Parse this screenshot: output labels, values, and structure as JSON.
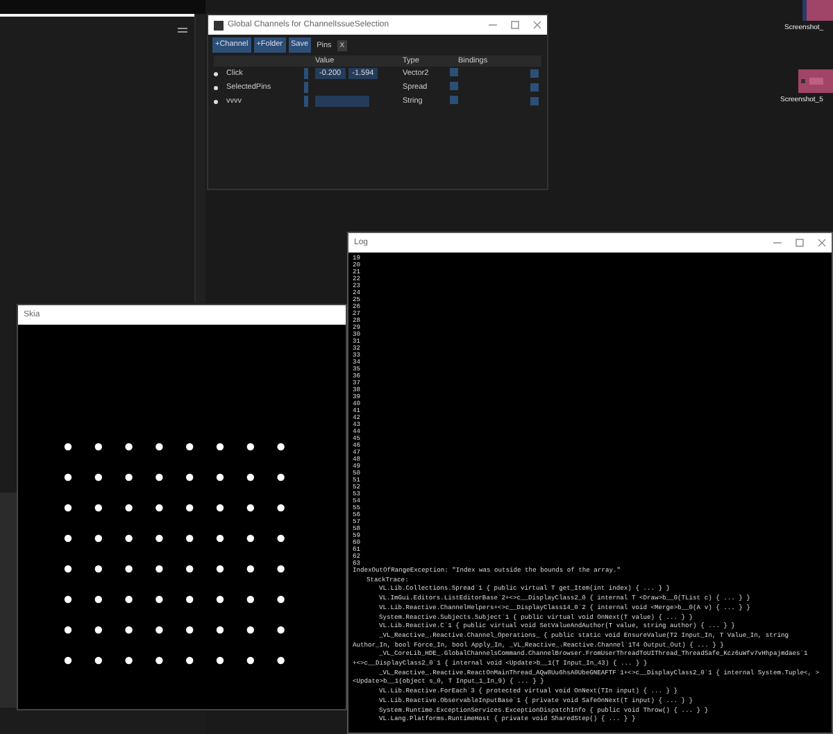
{
  "desktop_icons": [
    {
      "label": "Screenshot_"
    },
    {
      "label": "Screenshot_5"
    }
  ],
  "global_channels": {
    "title": "Global Channels for ChannelIssueSelection",
    "toolbar": [
      "+Channel",
      "+Folder",
      "Save"
    ],
    "tab": {
      "label": "Pins",
      "close": "X"
    },
    "columns": [
      "Value",
      "Type",
      "Bindings"
    ],
    "rows": [
      {
        "name": "Click",
        "kind": "vector",
        "values": [
          "-0.200",
          "-1.594"
        ],
        "type": "Vector2"
      },
      {
        "name": "SelectedPins",
        "kind": "spread",
        "type": "Spread"
      },
      {
        "name": "vvvv",
        "kind": "string",
        "type": "String"
      }
    ]
  },
  "skia": {
    "title": "Skia"
  },
  "log": {
    "title": "Log",
    "numbers": [
      "19",
      "20",
      "21",
      "22",
      "23",
      "24",
      "25",
      "26",
      "27",
      "28",
      "29",
      "30",
      "31",
      "32",
      "33",
      "34",
      "35",
      "36",
      "37",
      "38",
      "39",
      "40",
      "41",
      "42",
      "43",
      "44",
      "45",
      "46",
      "47",
      "48",
      "49",
      "50",
      "51",
      "52",
      "53",
      "54",
      "55",
      "56",
      "57",
      "58",
      "59",
      "60",
      "61",
      "62",
      "63"
    ],
    "exception": [
      {
        "kind": "message",
        "text": "IndexOutOfRangeException: \"Index was outside the bounds of the array.\""
      },
      {
        "kind": "label",
        "text": "StackTrace:"
      },
      {
        "kind": "frame",
        "text": "VL.Lib.Collections.Spread`1 { public virtual T get_Item(int index) { ... } }"
      },
      {
        "kind": "frame",
        "text": "VL.ImGui.Editors.ListEditorBase`2+<>c__DisplayClass2_0 { internal T <Draw>b__0(TList c) { ... } }"
      },
      {
        "kind": "frame",
        "text": "VL.Lib.Reactive.ChannelHelpers+<>c__DisplayClass14_0`2 { internal void <Merge>b__0(A v) { ... } }"
      },
      {
        "kind": "frame",
        "text": "System.Reactive.Subjects.Subject`1 { public virtual void OnNext(T value) { ... } }"
      },
      {
        "kind": "frame",
        "text": "VL.Lib.Reactive.C`1 { public virtual void SetValueAndAuthor(T value, string author) { ... } }"
      },
      {
        "kind": "frame",
        "text": "_VL_Reactive_.Reactive.Channel_Operations_ { public static void EnsureValue(T2 Input_In, T Value_In, string"
      },
      {
        "kind": "wrap",
        "text": "Author_In, bool Force_In, bool Apply_In, _VL_Reactive_.Reactive.Channel`1T4 Output_Out) { ... } }"
      },
      {
        "kind": "frame",
        "text": "_VL_CoreLib_HDE_.GlobalChannelsCommand.ChannelBrowser.FromUserThreadToUIThread_ThreadSafe_Kcz6uWfv7vHhpajmdaes`1"
      },
      {
        "kind": "wrap",
        "text": "+<>c__DisplayClass2_0`1 { internal void <Update>b__1(T Input_In_43) { ... } }"
      },
      {
        "kind": "frame",
        "text": "_VL_Reactive_.Reactive.ReactOnMainThread_AQw8Uu6hsA0UbeGNEAFTF`1+<>c__DisplayClass2_0`1 { internal System.Tuple<, >"
      },
      {
        "kind": "wrap",
        "text": "<Update>b__1(object s_0, T Input_1_In_9) { ... } }"
      },
      {
        "kind": "frame",
        "text": "VL.Lib.Reactive.ForEach`3 { protected virtual void OnNext(TIn input) { ... } }"
      },
      {
        "kind": "frame",
        "text": "VL.Lib.Reactive.ObservableInputBase`1 { private void SafeOnNext(T input) { ... } }"
      },
      {
        "kind": "frame",
        "text": "System.Runtime.ExceptionServices.ExceptionDispatchInfo { public void Throw() { ... } }"
      },
      {
        "kind": "frame",
        "text": "VL.Lang.Platforms.RuntimeHost { private void SharedStep() { ... } }"
      }
    ]
  }
}
